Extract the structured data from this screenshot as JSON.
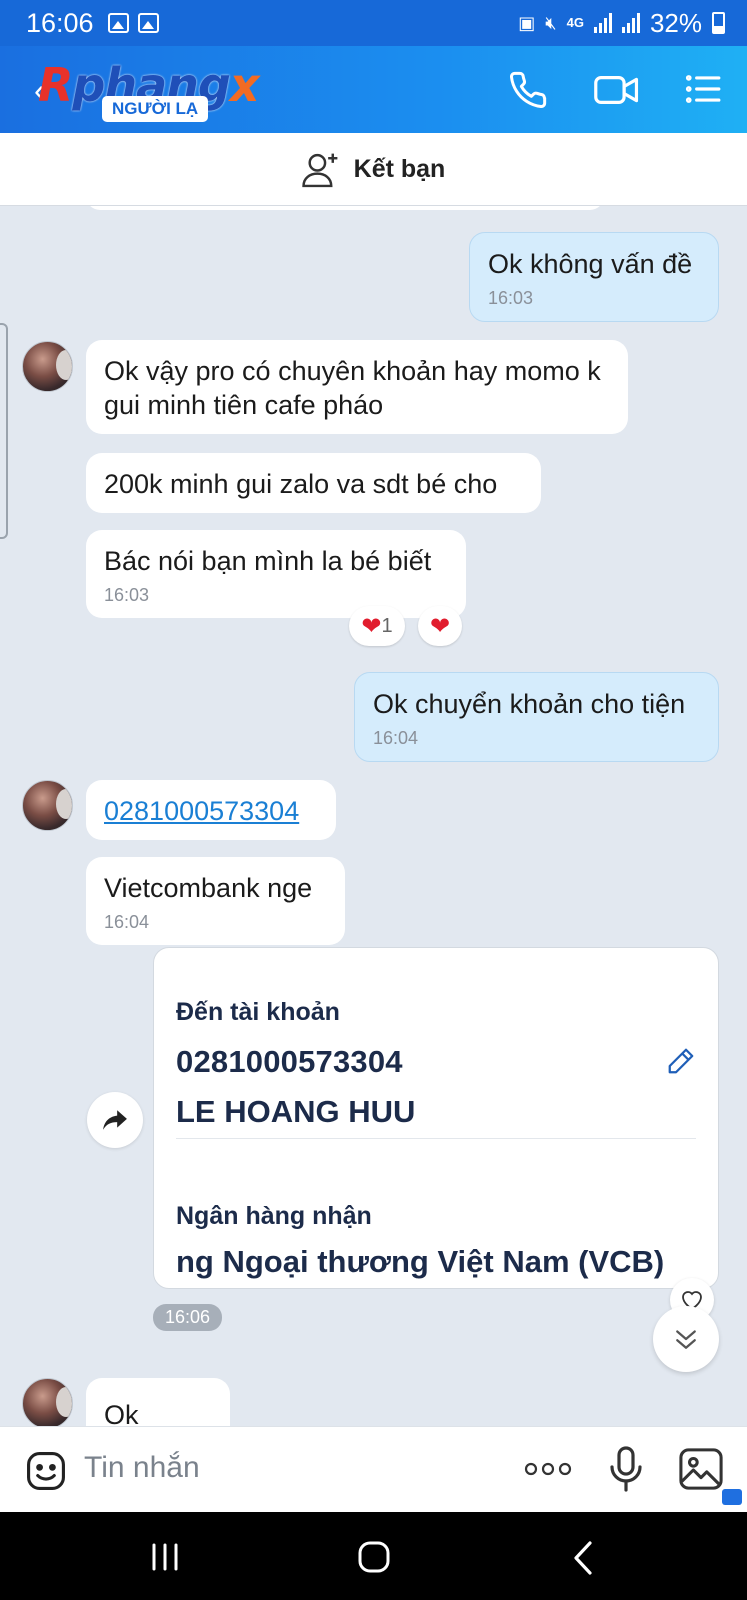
{
  "status_bar": {
    "time": "16:06",
    "network": "4G",
    "battery": "32%"
  },
  "header": {
    "logo_text_1": "R",
    "logo_text_2": "phang",
    "logo_text_3": "x",
    "stranger_label": "NGƯỜI LẠ",
    "icons": [
      "back-icon",
      "phone-icon",
      "video-call-icon",
      "menu-icon"
    ]
  },
  "add_friend": {
    "label": "Kết bạn"
  },
  "messages": [
    {
      "dir": "out",
      "text": "Ok không vấn đề",
      "time": "16:03"
    },
    {
      "dir": "in",
      "text": "Ok vậy pro có chuyên khoản hay momo k gui minh tiên cafe pháo"
    },
    {
      "dir": "in",
      "text": "200k minh gui zalo va sdt bé cho"
    },
    {
      "dir": "in",
      "text": "Bác nói bạn mình la bé biết",
      "time": "16:03",
      "reaction_count": "1"
    },
    {
      "dir": "out",
      "text": "Ok chuyển khoản cho tiện",
      "time": "16:04"
    },
    {
      "dir": "in",
      "text": "0281000573304",
      "link": true
    },
    {
      "dir": "in",
      "text": "Vietcombank nge",
      "time": "16:04"
    },
    {
      "dir": "in",
      "text": "Ok"
    }
  ],
  "transfer_card": {
    "to_account_title": "Đến tài khoản",
    "account_number": "0281000573304",
    "account_name": "LE HOANG HUU",
    "bank_title": "Ngân hàng nhận",
    "bank_name": "ng Ngoại thương Việt Nam (VCB)",
    "time": "16:06"
  },
  "input": {
    "placeholder": "Tin nhắn"
  },
  "colors": {
    "header_start": "#1a6fe0",
    "header_end": "#1fb0f4",
    "outgoing_bubble": "#d5ecfc",
    "incoming_bubble": "#ffffff",
    "chat_bg": "#e2e8f0",
    "link": "#1a7fd4"
  }
}
